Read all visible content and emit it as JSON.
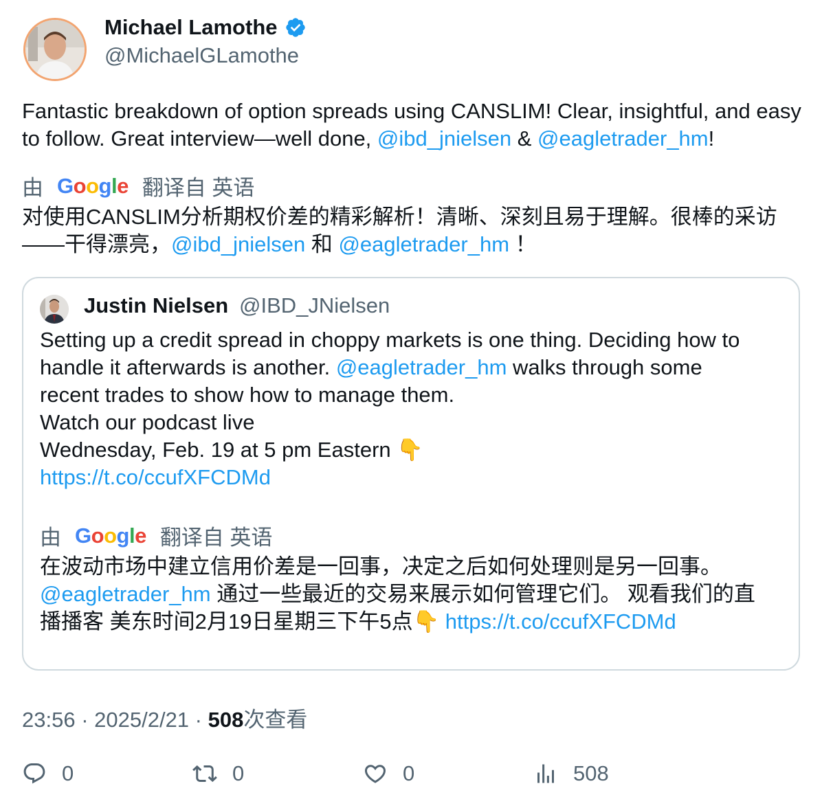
{
  "author": {
    "name": "Michael Lamothe",
    "handle": "@MichaelGLamothe"
  },
  "tweet": {
    "text_before": "Fantastic breakdown of option spreads using CANSLIM! Clear, insightful, and easy to follow. Great interview—well done, ",
    "mention1": "@ibd_jnielsen",
    "amp": " & ",
    "mention2": "@eagletrader_hm",
    "text_after": "!"
  },
  "translation": {
    "by_label": "由",
    "google_letters": [
      "G",
      "o",
      "o",
      "g",
      "l",
      "e"
    ],
    "from_label": "翻译自 英语",
    "text_before": "对使用CANSLIM分析期权价差的精彩解析！清晰、深刻且易于理解。很棒的采访——干得漂亮，",
    "mention1": "@ibd_jnielsen",
    "mid": " 和 ",
    "mention2": "@eagletrader_hm",
    "text_after": " ！"
  },
  "quote": {
    "name": "Justin Nielsen",
    "handle": "@IBD_JNielsen",
    "line1": "Setting up a credit spread in choppy markets is one thing. Deciding how to",
    "line2_before": "handle it afterwards is another.  ",
    "line2_mention": "@eagletrader_hm",
    "line2_after": " walks through some",
    "line3": "recent trades to show how to manage them.",
    "line4": "Watch our podcast live",
    "line5": "Wednesday, Feb. 19 at 5 pm Eastern 👇",
    "link": "https://t.co/ccufXFCDMd",
    "translation": {
      "by_label": "由",
      "from_label": "翻译自 英语",
      "line1": "在波动市场中建立信用价差是一回事，决定之后如何处理则是另一回事。",
      "line2_mention": "@eagletrader_hm",
      "line2_after": " 通过一些最近的交易来展示如何管理它们。 观看我们的直",
      "line3": "播播客 美东时间2月19日星期三下午5点👇 ",
      "link": "https://t.co/ccufXFCDMd"
    }
  },
  "meta": {
    "time": "23:56",
    "sep": " · ",
    "date": "2025/2/21",
    "views_count": "508",
    "views_label": "次查看"
  },
  "actions": {
    "reply_count": "0",
    "retweet_count": "0",
    "like_count": "0",
    "views_count": "508"
  },
  "colors": {
    "link": "#1d9bf0",
    "secondary_text": "#536471",
    "border": "#cfd9de"
  }
}
